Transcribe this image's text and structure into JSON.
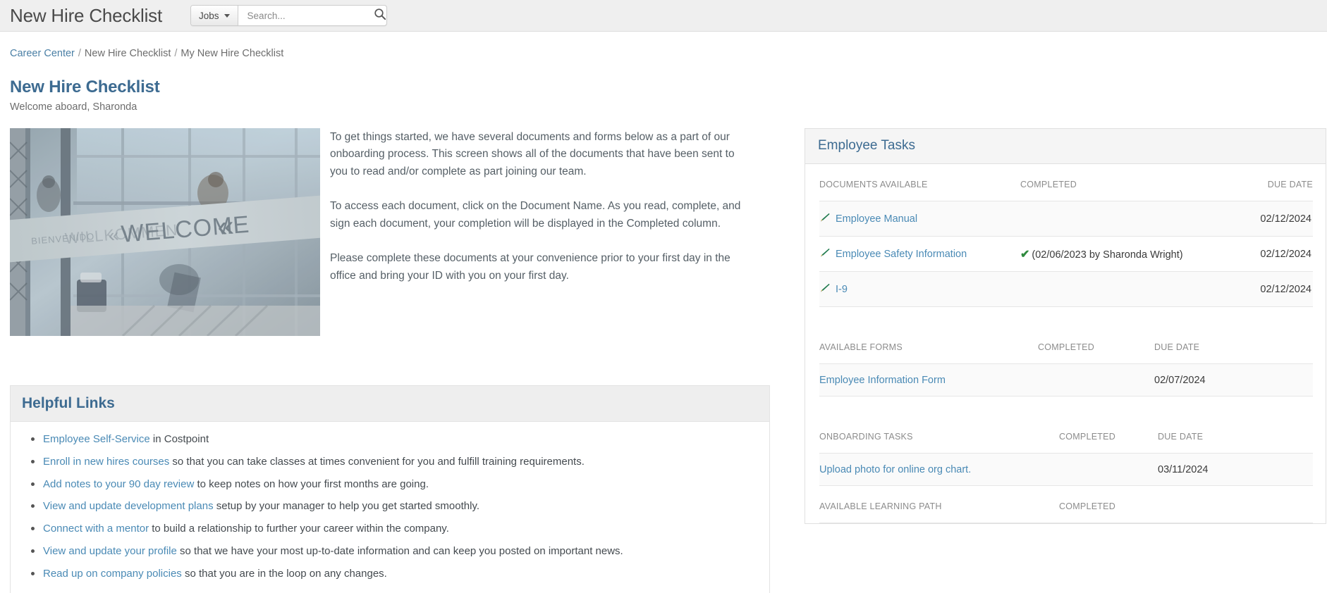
{
  "header": {
    "app_title": "New Hire Checklist",
    "search": {
      "scope_label": "Jobs",
      "placeholder": "Search...",
      "value": "",
      "icon": "search-icon"
    }
  },
  "breadcrumb": {
    "item1": "Career Center",
    "item2": "New Hire Checklist",
    "current": "My New Hire Checklist",
    "separator": "/"
  },
  "page": {
    "title": "New Hire Checklist",
    "subtitle": "Welcome aboard, Sharonda"
  },
  "intro": {
    "photo_alt": "welcome-sign-photo",
    "photo_sign_text": "WELCOME",
    "paragraphs": [
      "To get things started, we have several documents and forms below as a part of our onboarding process. This screen shows all of the documents that have been sent to you to read and/or complete as part joining our team.",
      "To access each document, click on the Document Name. As you read, complete, and sign each document, your completion will be displayed in the Completed column.",
      "Please complete these documents at your convenience prior to your first day in the office and bring your ID with you on your first day."
    ]
  },
  "helpful_links": {
    "title": "Helpful Links",
    "items": [
      {
        "link": "Employee Self-Service",
        "rest": " in Costpoint"
      },
      {
        "link": "Enroll in new hires courses",
        "rest": " so that you can take classes at times convenient for you and fulfill training requirements."
      },
      {
        "link": "Add notes to your 90 day review",
        "rest": " to keep notes on how your first months are going."
      },
      {
        "link": "View and update development plans",
        "rest": " setup by your manager to help you get started smoothly."
      },
      {
        "link": "Connect with a mentor",
        "rest": " to build a relationship to further your career within the company."
      },
      {
        "link": "View and update your profile",
        "rest": " so that we have your most up-to-date information and can keep you posted on important news."
      },
      {
        "link": "Read up on company policies",
        "rest": " so that you are in the loop on any changes."
      }
    ]
  },
  "tasks_panel": {
    "title": "Employee Tasks",
    "documents": {
      "col_name": "DOCUMENTS AVAILABLE",
      "col_completed": "COMPLETED",
      "col_due": "DUE DATE",
      "rows": [
        {
          "icon": "pencil-icon",
          "name": "Employee Manual",
          "completed": "",
          "due": "02/12/2024"
        },
        {
          "icon": "pencil-icon",
          "name": "Employee Safety Information",
          "completed": "(02/06/2023 by Sharonda Wright)",
          "completed_check": "✔",
          "due": "02/12/2024"
        },
        {
          "icon": "pencil-icon",
          "name": "I-9",
          "completed": "",
          "due": "02/12/2024"
        }
      ]
    },
    "forms": {
      "col_name": "AVAILABLE FORMS",
      "col_completed": "COMPLETED",
      "col_due": "DUE DATE",
      "rows": [
        {
          "name": "Employee Information Form",
          "completed": "",
          "due": "02/07/2024"
        }
      ]
    },
    "onboarding": {
      "col_name": "ONBOARDING TASKS",
      "col_completed": "COMPLETED",
      "col_due": "DUE DATE",
      "rows": [
        {
          "name": "Upload photo for online org chart.",
          "completed": "",
          "due": "03/11/2024"
        }
      ]
    },
    "learning": {
      "col_name": "AVAILABLE LEARNING PATH",
      "col_completed": "COMPLETED"
    }
  },
  "colors": {
    "accent_blue": "#3d6b91",
    "link_blue": "#4a8ab5",
    "header_bg": "#efefef",
    "panel_header_bg": "#f5f5f5",
    "check_green": "#2f8a3e",
    "row_alt": "#fafafa"
  }
}
